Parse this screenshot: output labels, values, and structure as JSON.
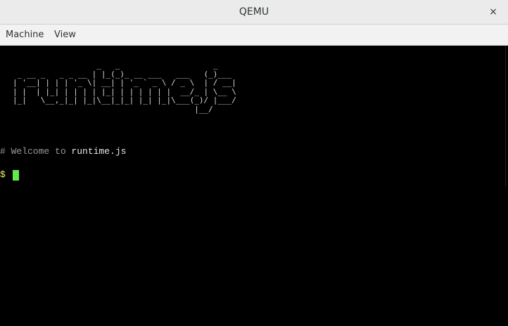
{
  "window": {
    "title": "QEMU",
    "close_label": "×"
  },
  "menubar": {
    "items": [
      "Machine",
      "View"
    ]
  },
  "terminal": {
    "logo_ascii": "                  _   _                    _\n _ __ _   _ _ __ | |_(_)_ __ ___   ___   (_)___\n| '__| | | | '_ \\| __| | '_ ` _ \\ / _ \\  | / __|\n| |  | |_| | | | | |_| | | | | | |  __/_ | \\__ \\\n|_|   \\__,_|_| |_|\\__|_|_| |_| |_|\\___(_)/ |___/\n                                       |__/",
    "welcome_prefix": "# Welcome to ",
    "welcome_name": "runtime.js",
    "prompt": "$"
  },
  "colors": {
    "background": "#000000",
    "prompt": "#f5f06a",
    "cursor": "#63e84a",
    "comment": "#9a9a9a"
  }
}
